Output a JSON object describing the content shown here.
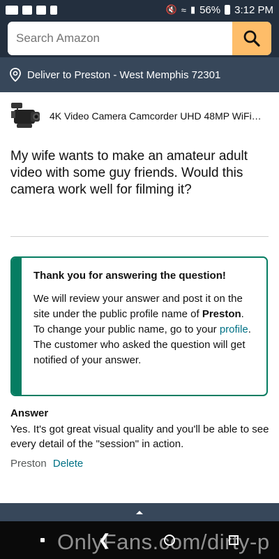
{
  "status_bar": {
    "battery": "56%",
    "time": "3:12 PM"
  },
  "search": {
    "placeholder": "Search Amazon"
  },
  "deliver": {
    "text": "Deliver to Preston - West Memphis 72301"
  },
  "product": {
    "title": "4K Video Camera Camcorder UHD 48MP WiFi…"
  },
  "question": {
    "text": "My wife wants to make an amateur adult video with some guy friends. Would this camera work well for filming it?"
  },
  "alert": {
    "title": "Thank you for answering the question!",
    "body_1": "We will review your answer and post it on the site under the public profile name of ",
    "profile_name": "Preston",
    "body_2": ". To change your public name, go to your ",
    "profile_link": "profile",
    "body_3": ". The customer who asked the question will get notified of your answer.",
    "accent_color": "#067d62"
  },
  "answer": {
    "heading": "Answer",
    "text": "Yes. It's got great visual quality and you'll be able to see every detail of the \"session\" in action.",
    "author": "Preston",
    "delete_label": "Delete"
  },
  "watermark": {
    "text": "OnlyFans.com/dirty-p"
  },
  "colors": {
    "header_bg": "#232f3e",
    "deliver_bg": "#37475a",
    "search_button": "#febd69",
    "link": "#007185"
  }
}
